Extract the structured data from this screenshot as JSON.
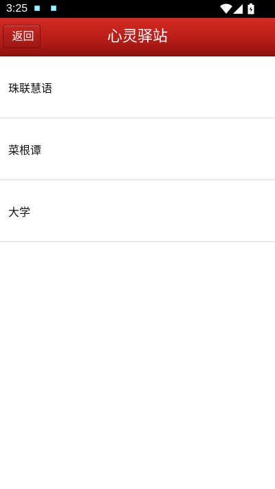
{
  "status_bar": {
    "time": "3:25",
    "icons": [
      "notification-icon",
      "notification-icon",
      "wifi-icon",
      "signal-icon",
      "battery-icon"
    ]
  },
  "header": {
    "back_label": "返回",
    "title": "心灵驿站",
    "color": "#b51d17"
  },
  "list": {
    "items": [
      {
        "label": "珠联慧语"
      },
      {
        "label": "菜根谭"
      },
      {
        "label": "大学"
      }
    ]
  }
}
